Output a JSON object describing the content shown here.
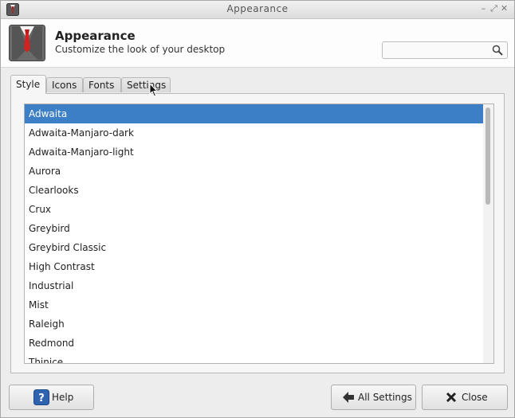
{
  "window": {
    "title": "Appearance"
  },
  "header": {
    "title": "Appearance",
    "subtitle": "Customize the look of your desktop",
    "icon": "suit-tie-icon"
  },
  "search": {
    "value": "",
    "placeholder": ""
  },
  "tabs": [
    {
      "label": "Style",
      "active": true
    },
    {
      "label": "Icons",
      "active": false
    },
    {
      "label": "Fonts",
      "active": false
    },
    {
      "label": "Settings",
      "active": false
    }
  ],
  "themes": [
    {
      "label": "Adwaita",
      "selected": true
    },
    {
      "label": "Adwaita-Manjaro-dark"
    },
    {
      "label": "Adwaita-Manjaro-light"
    },
    {
      "label": "Aurora"
    },
    {
      "label": "Clearlooks"
    },
    {
      "label": "Crux"
    },
    {
      "label": "Greybird"
    },
    {
      "label": "Greybird Classic"
    },
    {
      "label": "High Contrast"
    },
    {
      "label": "Industrial"
    },
    {
      "label": "Mist"
    },
    {
      "label": "Raleigh"
    },
    {
      "label": "Redmond"
    },
    {
      "label": "Thinice"
    }
  ],
  "footer": {
    "help_label": "Help",
    "all_settings_label": "All Settings",
    "close_label": "Close"
  },
  "colors": {
    "selection": "#3d7fc7",
    "help_icon": "#2f63b0"
  }
}
